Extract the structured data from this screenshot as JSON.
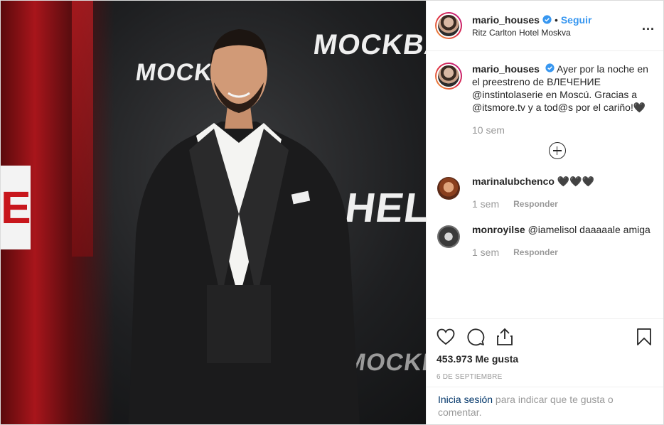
{
  "post": {
    "username": "mario_houses",
    "follow_label": "Seguir",
    "dot": "•",
    "location": "Ritz Carlton Hotel Moskva",
    "more_label": "..."
  },
  "photo": {
    "wall_texts": [
      "MOCKBA",
      "MOCKBA",
      "HELLO!",
      "MOCKBA"
    ],
    "red_sign": "E"
  },
  "caption": {
    "username": "mario_houses",
    "text": "Ayer por la noche en el preestreno de ВЛЕЧЕНИЕ @instintolaserie en Moscú. Gracias a @itsmore.tv y a tod@s por el cariño!🖤",
    "time": "10 sem"
  },
  "comments": [
    {
      "username": "marinalubchenco",
      "text": "🖤🖤🖤",
      "time": "1 sem",
      "reply": "Responder"
    },
    {
      "username": "monroyilse",
      "text": "@iamelisol daaaaale amiga",
      "time": "1 sem",
      "reply": "Responder"
    }
  ],
  "likes": "453.973 Me gusta",
  "date": "6 de septiembre",
  "login": {
    "link": "Inicia sesión",
    "rest": " para indicar que te gusta o comentar."
  },
  "colors": {
    "link_blue": "#3897f0",
    "muted": "#999999",
    "text": "#262626"
  },
  "icons": [
    "verified-icon",
    "heart-icon",
    "comment-icon",
    "share-icon",
    "bookmark-icon",
    "plus-circle-icon"
  ]
}
